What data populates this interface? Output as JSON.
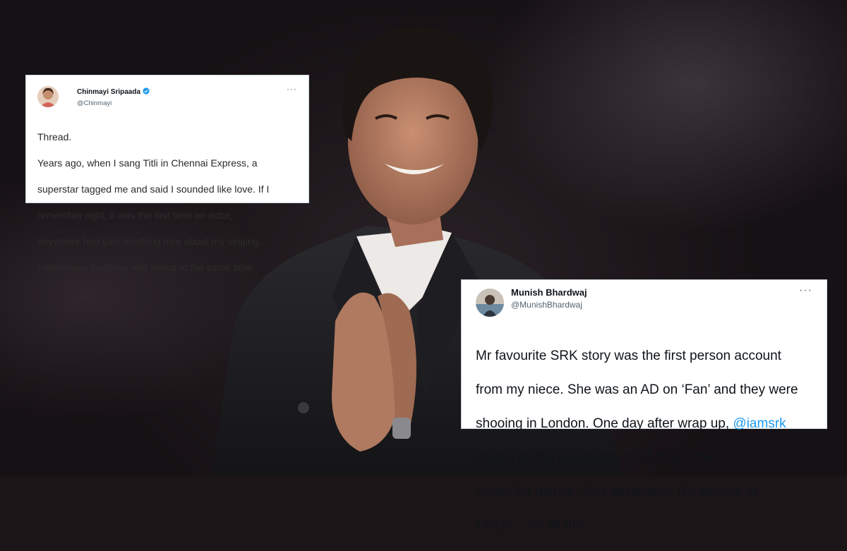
{
  "tweets": [
    {
      "name": "Chinmayi Sripaada",
      "handle": "@Chinmayi",
      "verified": true,
      "more_label": "···",
      "lines": [
        "Thread.",
        "Years ago, when I sang Titli in Chennai Express, a",
        "superstar tagged me and said I sounded like love. If I",
        "remember right, it was the first time an actor,",
        "anywhere had said anything nice about my singing.",
        "I remember laughing and crying at the same time."
      ]
    },
    {
      "name": "Munish Bhardwaj",
      "handle": "@MunishBhardwaj",
      "verified": false,
      "more_label": "···",
      "line1": "Mr favourite SRK story was the first person account",
      "line2": "from my niece. She was an AD on ‘Fan’ and they were",
      "line3_pre": "shooing in London. One day after wrap up, ",
      "mention": "@iamsrk",
      "line4": "invited all the assistants, of all departments to his",
      "line5": "house for dinner. Only assistants. No seniors or",
      "line6": "HODs… so all the"
    }
  ],
  "colors": {
    "link": "#1d9bf0",
    "verified": "#1d9bf0",
    "background": "#1b1518"
  },
  "icons": {
    "verified": "verified-badge-icon",
    "more": "more-options-icon"
  }
}
